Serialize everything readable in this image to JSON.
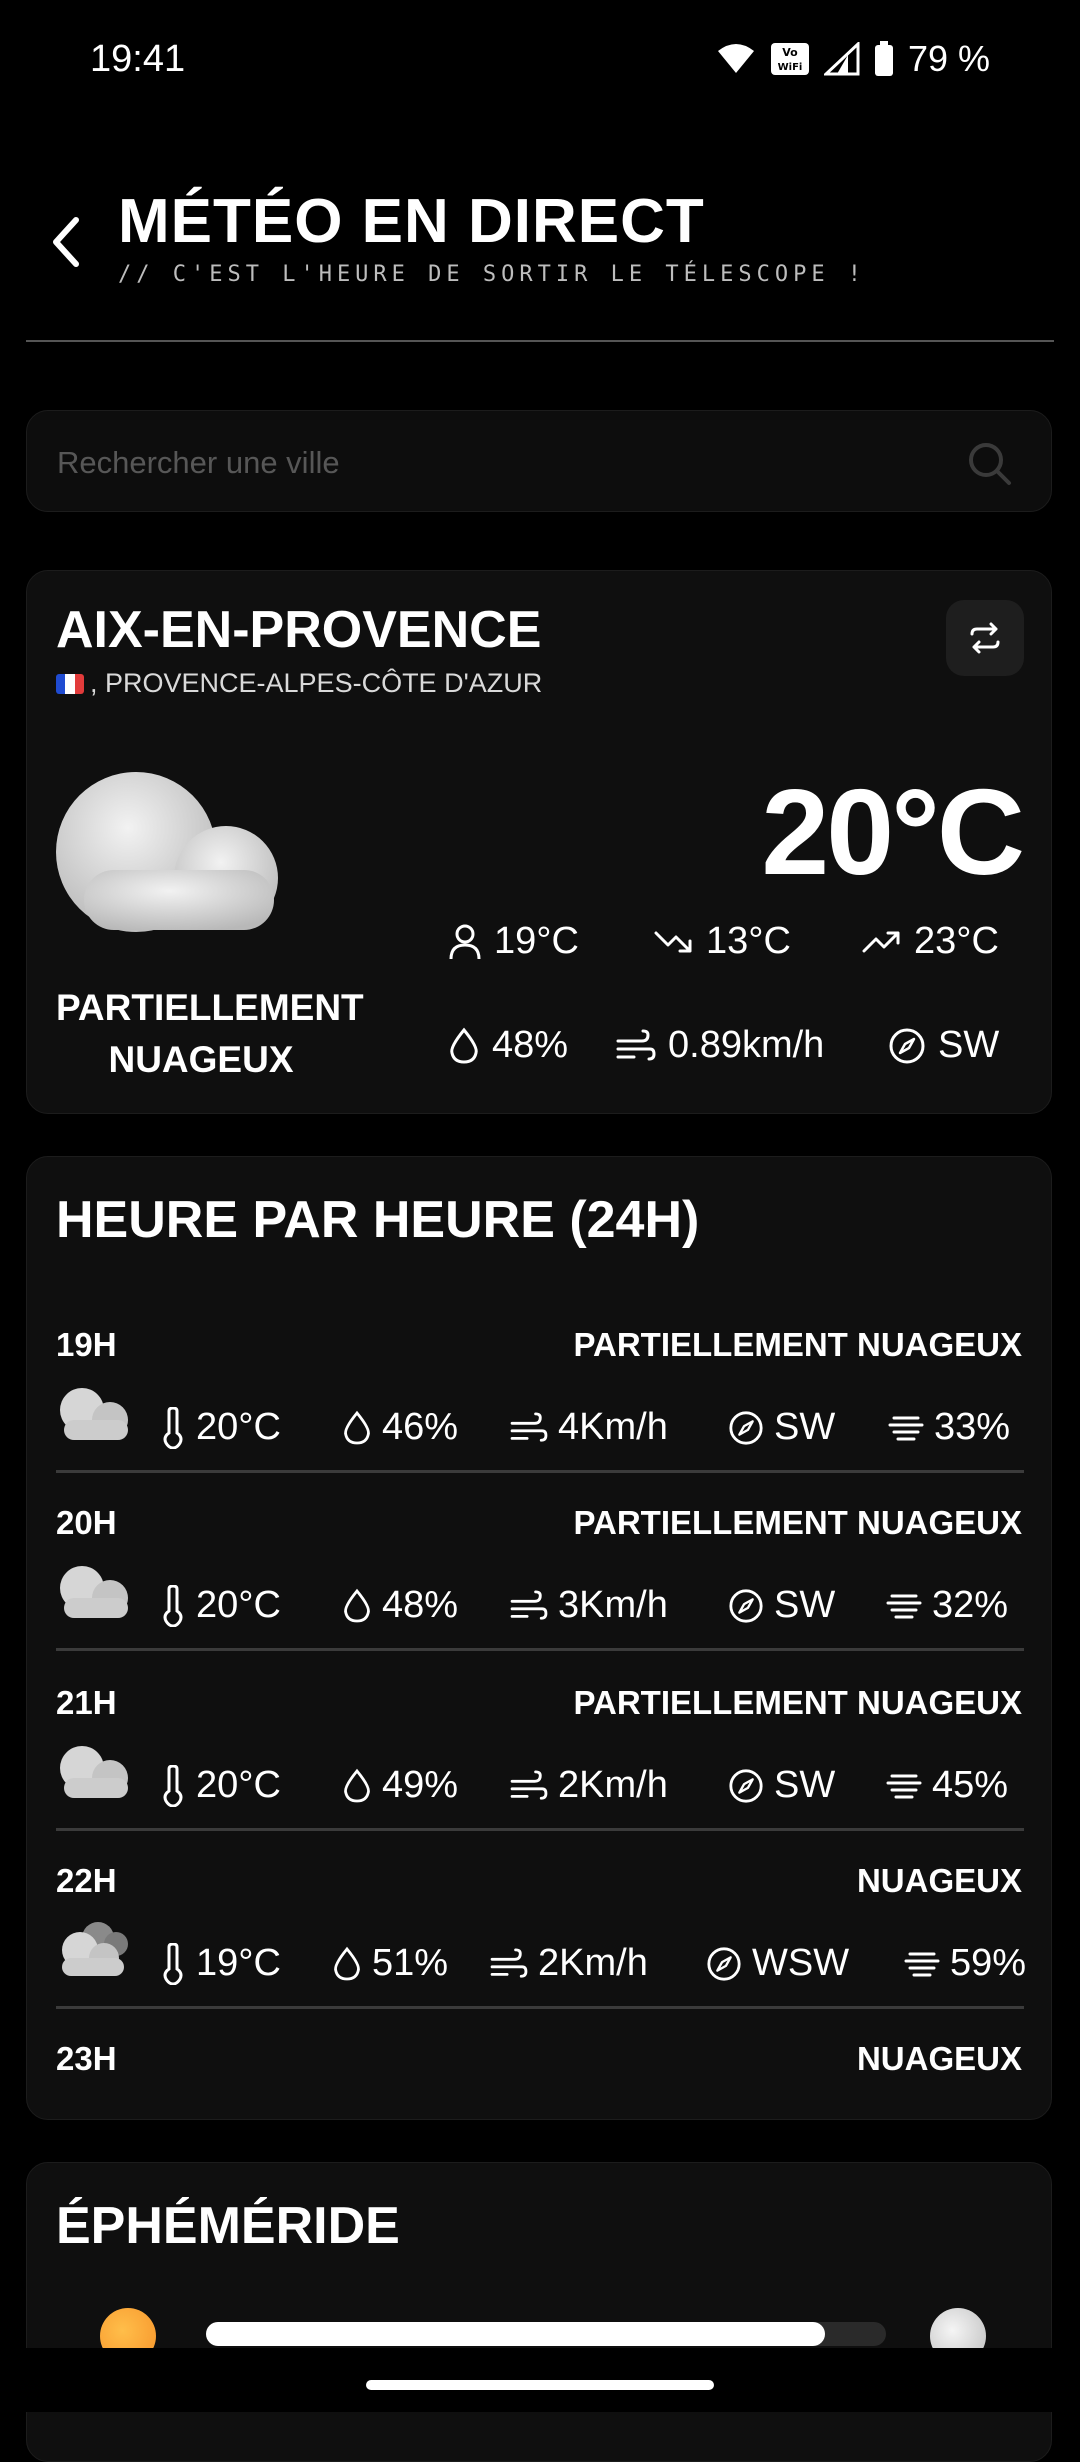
{
  "status_bar": {
    "time": "19:41",
    "network_badge": "Vo WiFi",
    "battery": "79 %"
  },
  "header": {
    "title": "MÉTÉO EN DIRECT",
    "subtitle": "// C'EST L'HEURE DE SORTIR LE TÉLESCOPE !"
  },
  "search": {
    "placeholder": "Rechercher une ville"
  },
  "current": {
    "city": "AIX-EN-PROVENCE",
    "region": ", PROVENCE-ALPES-CÔTE D'AZUR",
    "condition_line1": "PARTIELLEMENT",
    "condition_line2": "NUAGEUX",
    "temperature": "20°C",
    "feels_like": "19°C",
    "min": "13°C",
    "max": "23°C",
    "humidity": "48%",
    "wind": "0.89km/h",
    "direction": "SW"
  },
  "hourly": {
    "title": "HEURE PAR HEURE (24H)",
    "rows": [
      {
        "hour": "19H",
        "condition": "PARTIELLEMENT NUAGEUX",
        "temp": "20°C",
        "humidity": "46%",
        "wind": "4Km/h",
        "dir": "SW",
        "cloud": "33%"
      },
      {
        "hour": "20H",
        "condition": "PARTIELLEMENT NUAGEUX",
        "temp": "20°C",
        "humidity": "48%",
        "wind": "3Km/h",
        "dir": "SW",
        "cloud": "32%"
      },
      {
        "hour": "21H",
        "condition": "PARTIELLEMENT NUAGEUX",
        "temp": "20°C",
        "humidity": "49%",
        "wind": "2Km/h",
        "dir": "SW",
        "cloud": "45%"
      },
      {
        "hour": "22H",
        "condition": "NUAGEUX",
        "temp": "19°C",
        "humidity": "51%",
        "wind": "2Km/h",
        "dir": "WSW",
        "cloud": "59%"
      },
      {
        "hour": "23H",
        "condition": "NUAGEUX"
      }
    ]
  },
  "ephemeris": {
    "title": "ÉPHÉMÉRIDE",
    "day_progress": 0.91
  },
  "colors": {
    "background": "#000000",
    "card": "#0f0f0f",
    "sun": "#f7a233",
    "accent": "#ffffff"
  }
}
